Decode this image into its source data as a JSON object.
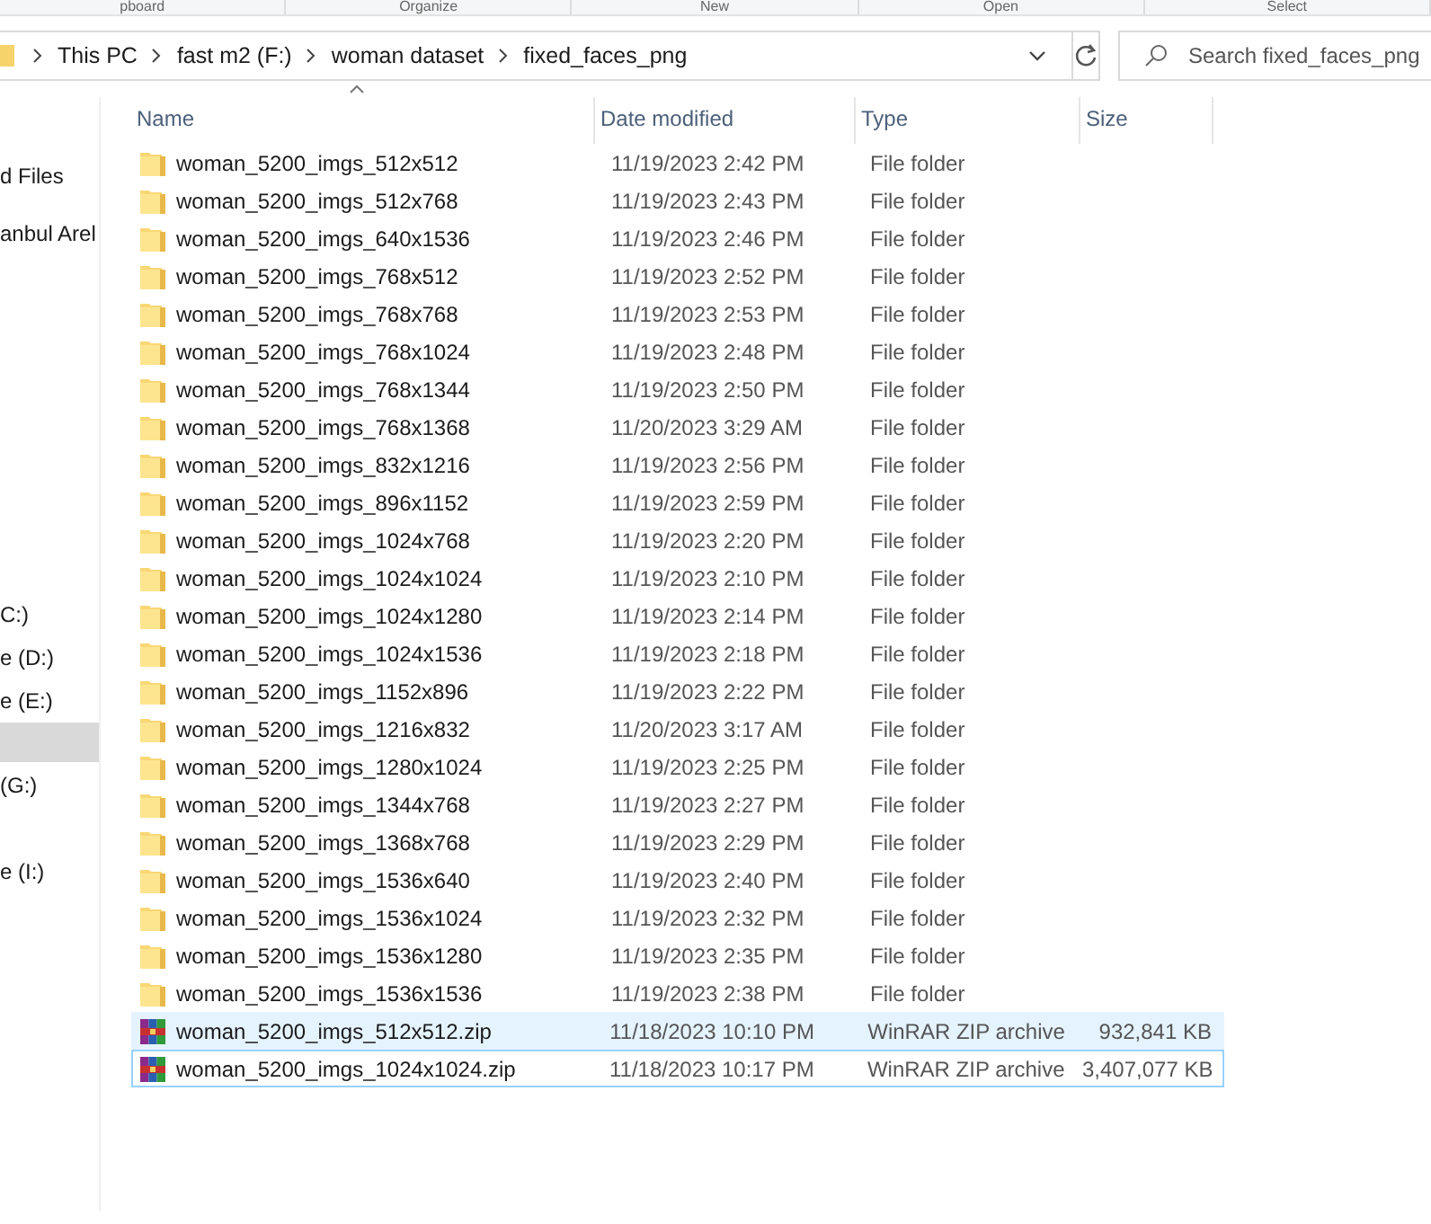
{
  "ribbon": {
    "groups": [
      "pboard",
      "Organize",
      "New",
      "Open",
      "Select"
    ]
  },
  "address_bar": {
    "crumbs": [
      "This PC",
      "fast m2 (F:)",
      "woman dataset",
      "fixed_faces_png"
    ]
  },
  "search": {
    "placeholder": "Search fixed_faces_png"
  },
  "sidebar": {
    "items": [
      {
        "label": "d Files",
        "selected": false
      },
      {
        "label": "anbul Arel",
        "selected": false
      },
      {
        "label": "C:)",
        "selected": false
      },
      {
        "label": "e (D:)",
        "selected": false
      },
      {
        "label": "e (E:)",
        "selected": false
      },
      {
        "selected": true
      },
      {
        "label": "(G:)",
        "selected": false
      },
      {
        "label": "e (I:)",
        "selected": false
      }
    ]
  },
  "table": {
    "columns": [
      "Name",
      "Date modified",
      "Type",
      "Size"
    ],
    "rows": [
      {
        "kind": "folder",
        "name": "woman_5200_imgs_512x512",
        "date": "11/19/2023 2:42 PM",
        "type": "File folder",
        "selected": false,
        "focused": false
      },
      {
        "kind": "folder",
        "name": "woman_5200_imgs_512x768",
        "date": "11/19/2023 2:43 PM",
        "type": "File folder",
        "selected": false,
        "focused": false
      },
      {
        "kind": "folder",
        "name": "woman_5200_imgs_640x1536",
        "date": "11/19/2023 2:46 PM",
        "type": "File folder",
        "selected": false,
        "focused": false
      },
      {
        "kind": "folder",
        "name": "woman_5200_imgs_768x512",
        "date": "11/19/2023 2:52 PM",
        "type": "File folder",
        "selected": false,
        "focused": false
      },
      {
        "kind": "folder",
        "name": "woman_5200_imgs_768x768",
        "date": "11/19/2023 2:53 PM",
        "type": "File folder",
        "selected": false,
        "focused": false
      },
      {
        "kind": "folder",
        "name": "woman_5200_imgs_768x1024",
        "date": "11/19/2023 2:48 PM",
        "type": "File folder",
        "selected": false,
        "focused": false
      },
      {
        "kind": "folder",
        "name": "woman_5200_imgs_768x1344",
        "date": "11/19/2023 2:50 PM",
        "type": "File folder",
        "selected": false,
        "focused": false
      },
      {
        "kind": "folder",
        "name": "woman_5200_imgs_768x1368",
        "date": "11/20/2023 3:29 AM",
        "type": "File folder",
        "selected": false,
        "focused": false
      },
      {
        "kind": "folder",
        "name": "woman_5200_imgs_832x1216",
        "date": "11/19/2023 2:56 PM",
        "type": "File folder",
        "selected": false,
        "focused": false
      },
      {
        "kind": "folder",
        "name": "woman_5200_imgs_896x1152",
        "date": "11/19/2023 2:59 PM",
        "type": "File folder",
        "selected": false,
        "focused": false
      },
      {
        "kind": "folder",
        "name": "woman_5200_imgs_1024x768",
        "date": "11/19/2023 2:20 PM",
        "type": "File folder",
        "selected": false,
        "focused": false
      },
      {
        "kind": "folder",
        "name": "woman_5200_imgs_1024x1024",
        "date": "11/19/2023 2:10 PM",
        "type": "File folder",
        "selected": false,
        "focused": false
      },
      {
        "kind": "folder",
        "name": "woman_5200_imgs_1024x1280",
        "date": "11/19/2023 2:14 PM",
        "type": "File folder",
        "selected": false,
        "focused": false
      },
      {
        "kind": "folder",
        "name": "woman_5200_imgs_1024x1536",
        "date": "11/19/2023 2:18 PM",
        "type": "File folder",
        "selected": false,
        "focused": false
      },
      {
        "kind": "folder",
        "name": "woman_5200_imgs_1152x896",
        "date": "11/19/2023 2:22 PM",
        "type": "File folder",
        "selected": false,
        "focused": false
      },
      {
        "kind": "folder",
        "name": "woman_5200_imgs_1216x832",
        "date": "11/20/2023 3:17 AM",
        "type": "File folder",
        "selected": false,
        "focused": false
      },
      {
        "kind": "folder",
        "name": "woman_5200_imgs_1280x1024",
        "date": "11/19/2023 2:25 PM",
        "type": "File folder",
        "selected": false,
        "focused": false
      },
      {
        "kind": "folder",
        "name": "woman_5200_imgs_1344x768",
        "date": "11/19/2023 2:27 PM",
        "type": "File folder",
        "selected": false,
        "focused": false
      },
      {
        "kind": "folder",
        "name": "woman_5200_imgs_1368x768",
        "date": "11/19/2023 2:29 PM",
        "type": "File folder",
        "selected": false,
        "focused": false
      },
      {
        "kind": "folder",
        "name": "woman_5200_imgs_1536x640",
        "date": "11/19/2023 2:40 PM",
        "type": "File folder",
        "selected": false,
        "focused": false
      },
      {
        "kind": "folder",
        "name": "woman_5200_imgs_1536x1024",
        "date": "11/19/2023 2:32 PM",
        "type": "File folder",
        "selected": false,
        "focused": false
      },
      {
        "kind": "folder",
        "name": "woman_5200_imgs_1536x1280",
        "date": "11/19/2023 2:35 PM",
        "type": "File folder",
        "selected": false,
        "focused": false
      },
      {
        "kind": "folder",
        "name": "woman_5200_imgs_1536x1536",
        "date": "11/19/2023 2:38 PM",
        "type": "File folder",
        "selected": false,
        "focused": false
      },
      {
        "kind": "archive",
        "name": "woman_5200_imgs_512x512.zip",
        "date": "11/18/2023 10:10 PM",
        "type": "WinRAR ZIP archive",
        "size": "932,841 KB",
        "selected": true,
        "focused": false
      },
      {
        "kind": "archive",
        "name": "woman_5200_imgs_1024x1024.zip",
        "date": "11/18/2023 10:17 PM",
        "type": "WinRAR ZIP archive",
        "size": "3,407,077 KB",
        "selected": false,
        "focused": true
      }
    ]
  }
}
